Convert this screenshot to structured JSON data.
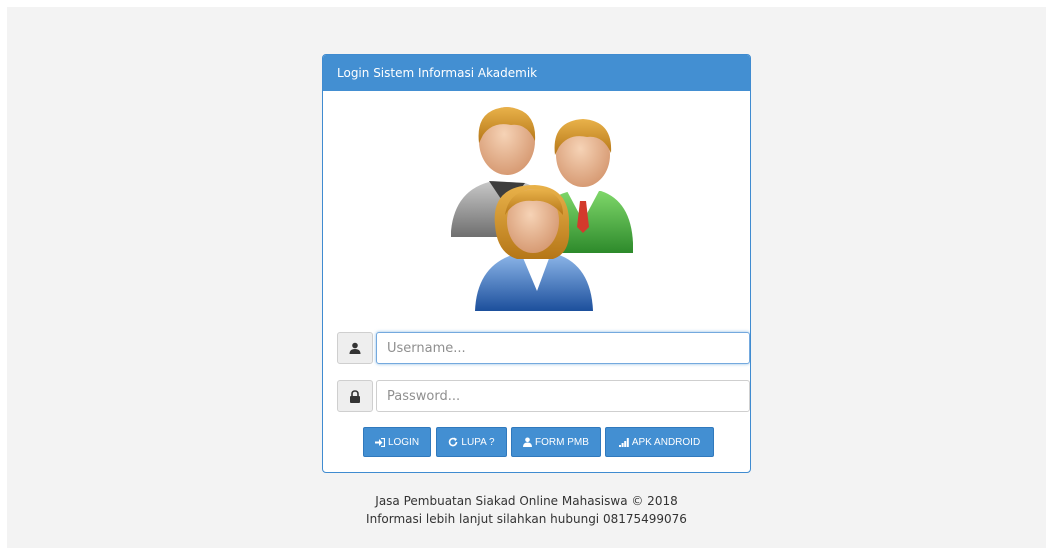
{
  "panel": {
    "title": "Login Sistem Informasi Akademik"
  },
  "icons": {
    "avatar": "users-group-icon",
    "username": "user-icon",
    "password": "lock-icon",
    "login": "sign-in-icon",
    "reset": "refresh-icon",
    "form": "user-icon",
    "android": "signal-icon"
  },
  "form": {
    "username_placeholder": "Username...",
    "password_placeholder": "Password..."
  },
  "buttons": {
    "login": "LOGIN",
    "lupa": "LUPA ?",
    "form_pmb": "FORM PMB",
    "apk_android": "APK ANDROID"
  },
  "footer": {
    "line1": "Jasa Pembuatan Siakad Online Mahasiswa © 2018",
    "line2": "Informasi lebih lanjut silahkan hubungi 08175499076"
  },
  "colors": {
    "primary": "#438fd2",
    "background": "#f3f3f3"
  }
}
